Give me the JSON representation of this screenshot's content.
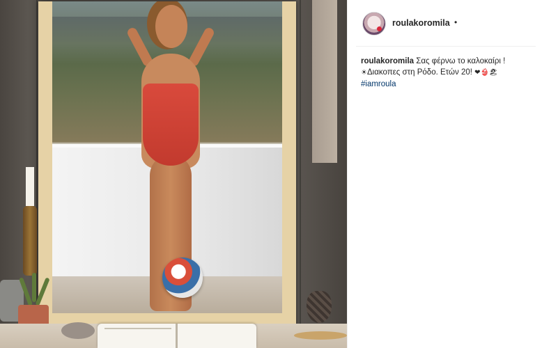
{
  "post": {
    "username": "roulakoromila",
    "separator": "•",
    "caption": {
      "username": "roulakoromila",
      "line1": "Σας φέρνω το καλοκαίρι !",
      "line2_icon": "☀",
      "line2": "Διακοπες στη Ρόδο. Ετών 20!",
      "line2_emojis": "❤👙🏖",
      "hashtag": "#iamroula"
    }
  },
  "colors": {
    "link": "#003569",
    "text": "#262626",
    "border": "#efefef"
  },
  "icons": {
    "avatar": "profile-avatar",
    "sun": "sun-icon",
    "emojis": "heart-bikini-beach-icons"
  }
}
